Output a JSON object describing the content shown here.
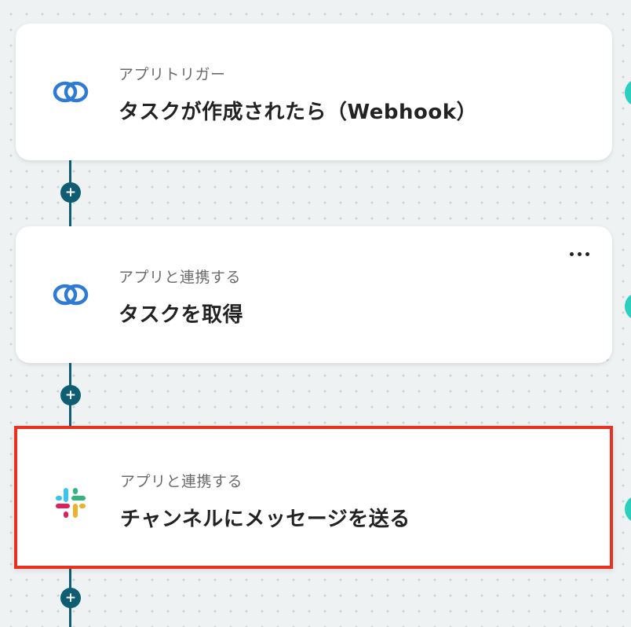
{
  "flow": {
    "steps": [
      {
        "subtitle": "アプリトリガー",
        "title": "タスクが作成されたら（Webhook）",
        "app_icon": "clickup-icon"
      },
      {
        "subtitle": "アプリと連携する",
        "title": "タスクを取得",
        "app_icon": "clickup-icon"
      },
      {
        "subtitle": "アプリと連携する",
        "title": "チャンネルにメッセージを送る",
        "app_icon": "slack-icon"
      }
    ],
    "add_button_symbol": "+",
    "selected_step": 3
  },
  "colors": {
    "connector": "#0f5d73",
    "selection_border": "#e8321f",
    "side_dot": "#2ccfbd",
    "clickup_blue": "#2f7bd3"
  }
}
